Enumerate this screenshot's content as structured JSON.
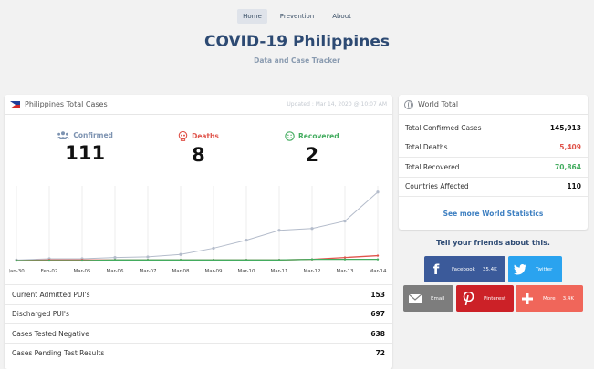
{
  "nav": [
    {
      "label": "Home",
      "active": true
    },
    {
      "label": "Prevention",
      "active": false
    },
    {
      "label": "About",
      "active": false
    }
  ],
  "header": {
    "title": "COVID-19 Philippines",
    "subtitle": "Data and Case Tracker"
  },
  "ph_card": {
    "title": "Philippines Total Cases",
    "updated": "Updated : Mar 14, 2020 @ 10:07 AM",
    "stats": {
      "confirmed": {
        "label": "Confirmed",
        "value": "111",
        "icon": "people-icon",
        "color": "#7d93b1"
      },
      "deaths": {
        "label": "Deaths",
        "value": "8",
        "icon": "skull-icon",
        "color": "#e0554c"
      },
      "recovered": {
        "label": "Recovered",
        "value": "2",
        "icon": "smiley-icon",
        "color": "#43ac5f"
      }
    },
    "rows": [
      {
        "label": "Current Admitted PUI's",
        "value": "153"
      },
      {
        "label": "Discharged PUI's",
        "value": "697"
      },
      {
        "label": "Cases Tested Negative",
        "value": "638"
      },
      {
        "label": "Cases Pending Test Results",
        "value": "72"
      }
    ]
  },
  "chart_data": {
    "type": "line",
    "categories": [
      "Jan-30",
      "Feb-02",
      "Mar-05",
      "Mar-06",
      "Mar-07",
      "Mar-08",
      "Mar-09",
      "Mar-10",
      "Mar-11",
      "Mar-12",
      "Mar-13",
      "Mar-14"
    ],
    "series": [
      {
        "color": "#b4bccb",
        "values": [
          1,
          3,
          3,
          5,
          6,
          10,
          20,
          33,
          49,
          52,
          64,
          111
        ]
      },
      {
        "color": "#e0554c",
        "values": [
          0,
          1,
          1,
          1,
          1,
          1,
          1,
          1,
          1,
          2,
          5,
          8
        ]
      },
      {
        "color": "#43ac5f",
        "values": [
          0,
          0,
          0,
          1,
          1,
          1,
          1,
          1,
          1,
          2,
          2,
          2
        ]
      }
    ],
    "ylim": [
      0,
      115
    ],
    "grid": "vertical"
  },
  "world_card": {
    "title": "World Total",
    "rows": [
      {
        "label": "Total Confirmed Cases",
        "value": "145,913",
        "color": "#111111"
      },
      {
        "label": "Total Deaths",
        "value": "5,409",
        "color": "#e0554c"
      },
      {
        "label": "Total Recovered",
        "value": "70,864",
        "color": "#43ac5f"
      },
      {
        "label": "Countries Affected",
        "value": "110",
        "color": "#111111"
      }
    ],
    "link": "See more World Statistics"
  },
  "share": {
    "title": "Tell your friends about this.",
    "facebook": {
      "label": "Facebook",
      "count": "35.4K"
    },
    "twitter": {
      "label": "Twitter"
    },
    "email": {
      "label": "Email"
    },
    "pinterest": {
      "label": "Pinterest"
    },
    "more": {
      "label": "More",
      "count": "3.4K"
    }
  }
}
